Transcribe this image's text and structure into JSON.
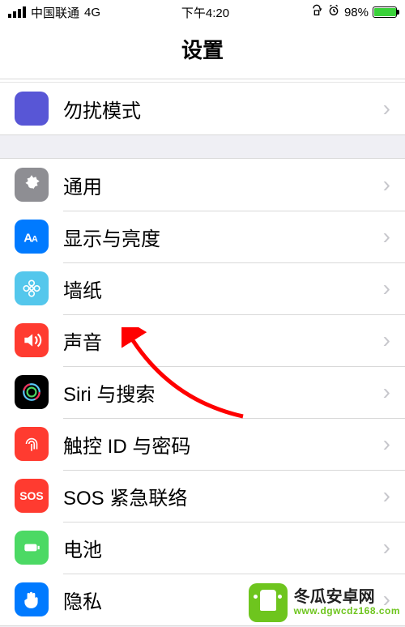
{
  "status": {
    "carrier": "中国联通",
    "network": "4G",
    "time": "下午4:20",
    "battery_pct": "98%"
  },
  "header": {
    "title": "设置"
  },
  "group1": {
    "items": [
      {
        "label": "勿扰模式",
        "icon": "moon-icon"
      }
    ]
  },
  "group2": {
    "items": [
      {
        "label": "通用",
        "icon": "gear-icon"
      },
      {
        "label": "显示与亮度",
        "icon": "text-size-icon"
      },
      {
        "label": "墙纸",
        "icon": "flower-icon"
      },
      {
        "label": "声音",
        "icon": "speaker-icon"
      },
      {
        "label": "Siri 与搜索",
        "icon": "siri-icon"
      },
      {
        "label": "触控 ID 与密码",
        "icon": "fingerprint-icon"
      },
      {
        "label": "SOS 紧急联络",
        "icon": "sos-icon",
        "icon_text": "SOS"
      },
      {
        "label": "电池",
        "icon": "battery-icon"
      },
      {
        "label": "隐私",
        "icon": "hand-icon"
      }
    ]
  },
  "watermark": {
    "name": "冬瓜安卓网",
    "url": "www.dgwcdz168.com"
  }
}
